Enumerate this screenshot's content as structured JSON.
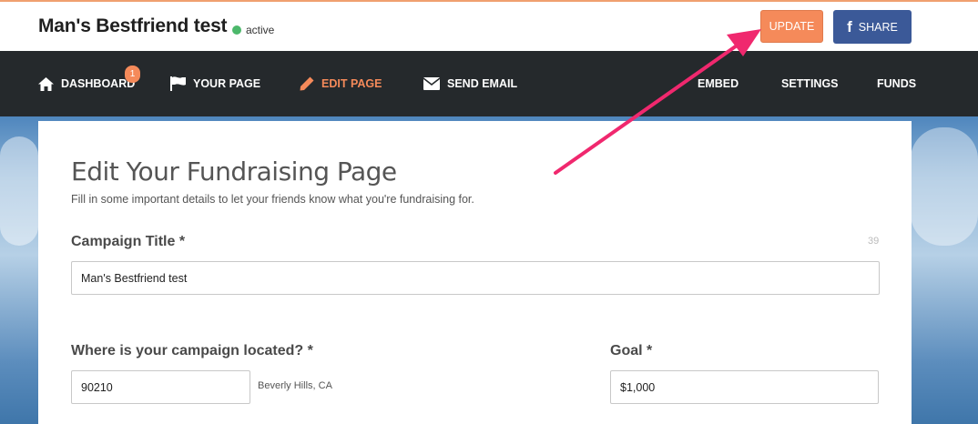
{
  "header": {
    "campaign_name": "Man's Bestfriend test",
    "status": "active",
    "update_label": "UPDATE",
    "share_label": "SHARE"
  },
  "nav": {
    "items": [
      {
        "label": "DASHBOARD",
        "icon": "home-icon",
        "badge": "1"
      },
      {
        "label": "YOUR PAGE",
        "icon": "flag-icon"
      },
      {
        "label": "EDIT PAGE",
        "icon": "pencil-icon",
        "active": true
      },
      {
        "label": "SEND EMAIL",
        "icon": "envelope-icon"
      },
      {
        "label": "EMBED"
      },
      {
        "label": "SETTINGS"
      },
      {
        "label": "FUNDS"
      }
    ]
  },
  "form": {
    "title": "Edit Your Fundraising Page",
    "subtitle": "Fill in some important details to let your friends know what you're fundraising for.",
    "campaign_title_label": "Campaign Title *",
    "campaign_title_count": "39",
    "campaign_title_value": "Man's Bestfriend test",
    "location_label": "Where is your campaign located? *",
    "location_value": "90210",
    "location_hint": "Beverly Hills, CA",
    "goal_label": "Goal *",
    "goal_value": "$1,000"
  },
  "colors": {
    "accent": "#f58a5a",
    "facebook": "#3b5998",
    "nav_bg": "#25292c",
    "status_green": "#4cb86b",
    "annotation_arrow": "#f0286e"
  }
}
